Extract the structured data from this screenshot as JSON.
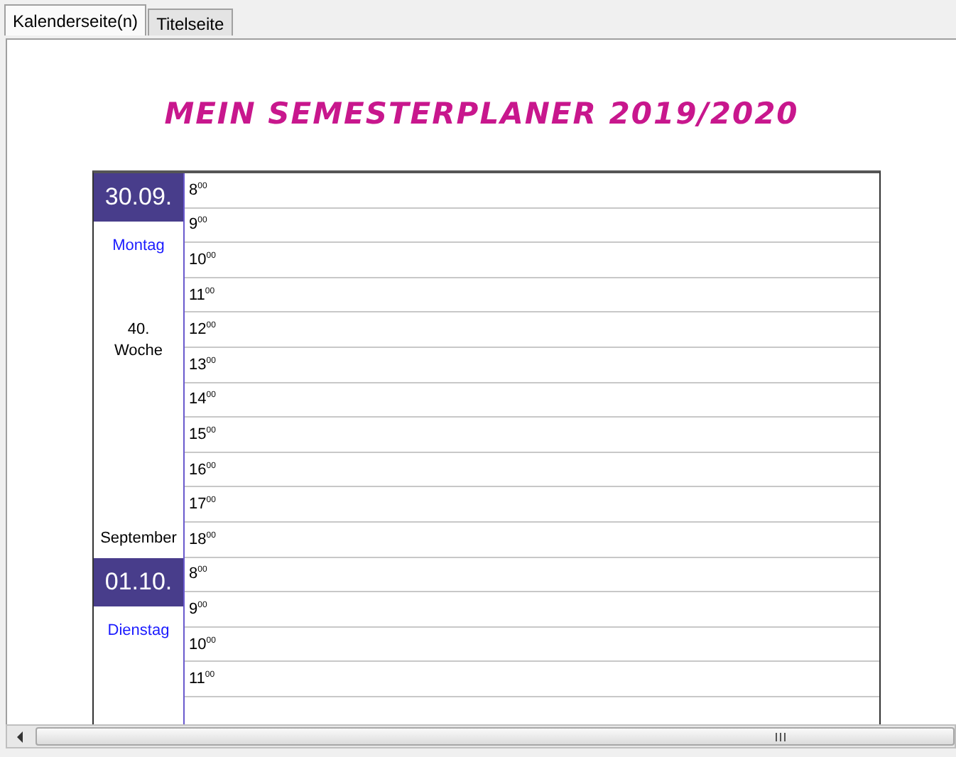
{
  "tabs": [
    {
      "label": "Kalenderseite(n)",
      "selected": true
    },
    {
      "label": "Titelseite",
      "selected": false
    }
  ],
  "title": "MEIN SEMESTERPLANER 2019/2020",
  "days": [
    {
      "date": "30.09.",
      "weekday": "Montag",
      "week": "40.\nWoche",
      "month": "September",
      "hours": [
        "8$^{00}$",
        "9$^{00}$",
        "10$^{00}$",
        "11$^{00}$",
        "12$^{00}$",
        "13$^{00}$",
        "14$^{00}$",
        "15$^{00}$",
        "16$^{00}$",
        "17$^{00}$",
        "18$^{00}$"
      ]
    },
    {
      "date": "01.10.",
      "weekday": "Dienstag",
      "hours": [
        "8$^{00}$",
        "9$^{00}$",
        "10$^{00}$",
        "11$^{00}$"
      ]
    }
  ]
}
